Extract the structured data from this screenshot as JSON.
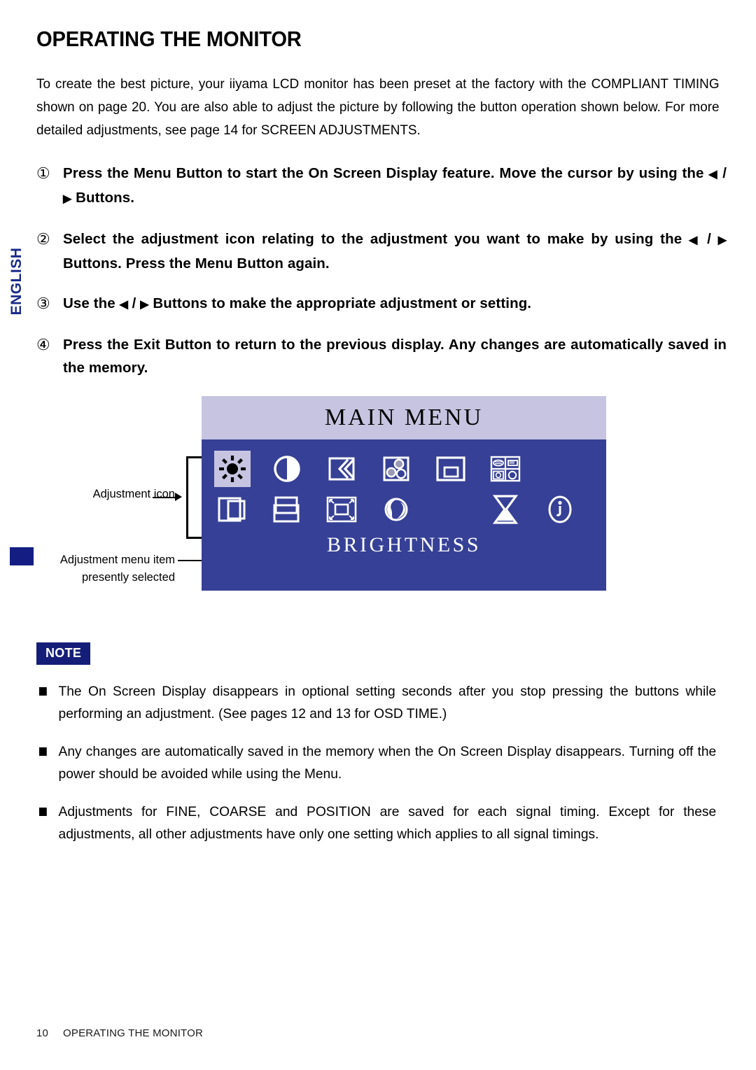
{
  "side_tab": {
    "language": "ENGLISH"
  },
  "page_title": "OPERATING THE MONITOR",
  "intro": "To create the best picture, your iiyama LCD monitor has been preset at the factory with the COMPLIANT TIMING shown on page 20. You are also able to adjust the picture by following the button operation shown below. For more detailed adjustments, see page 14 for SCREEN ADJUSTMENTS.",
  "steps": [
    {
      "marker": "①",
      "a": "Press the Menu Button to start the On Screen Display feature. Move the cursor by using the ",
      "left": "◀",
      "sep": " / ",
      "right": "▶",
      "b": " Buttons."
    },
    {
      "marker": "②",
      "a": "Select the adjustment icon relating to the adjustment you want to make by using the ",
      "left": "◀",
      "sep": " / ",
      "right": "▶",
      "b": " Buttons. Press the Menu Button again."
    },
    {
      "marker": "③",
      "a": "Use the ",
      "left": "◀",
      "sep": " / ",
      "right": "▶",
      "b": " Buttons to make the appropriate adjustment or setting."
    },
    {
      "marker": "④",
      "a": "Press the Exit Button to return to the previous display. Any changes are automatically saved in the memory.",
      "left": "",
      "sep": "",
      "right": "",
      "b": ""
    }
  ],
  "annotations": {
    "adjustment_icon": "Adjustment icon",
    "menu_item_line1": "Adjustment menu item",
    "menu_item_line2": "presently selected"
  },
  "osd": {
    "header_title": "MAIN MENU",
    "selected_item_label": "BRIGHTNESS",
    "colors": {
      "header_bg": "#c6c4e0",
      "body_bg": "#364096",
      "selected_icon_bg": "#c6c4e0",
      "icon_stroke": "#ffffff"
    },
    "icons_row1": [
      {
        "name": "brightness-icon",
        "selected": true
      },
      {
        "name": "contrast-icon",
        "selected": false
      },
      {
        "name": "sharpness-icon",
        "selected": false
      },
      {
        "name": "color-temperature-icon",
        "selected": false
      },
      {
        "name": "osd-position-icon",
        "selected": false
      },
      {
        "name": "language-icon",
        "selected": false
      }
    ],
    "icons_row2": [
      {
        "name": "horizontal-position-icon",
        "selected": false
      },
      {
        "name": "vertical-position-icon",
        "selected": false
      },
      {
        "name": "zoom-size-icon",
        "selected": false
      },
      {
        "name": "globe-icon",
        "selected": false
      },
      {
        "name": "osd-time-hourglass-icon",
        "selected": false
      },
      {
        "name": "information-icon",
        "selected": false
      }
    ]
  },
  "note": {
    "badge": "NOTE",
    "badge_color": "#141e78",
    "items": [
      "The On Screen Display disappears in optional setting seconds after you stop pressing the buttons while performing an adjustment. (See pages 12 and 13 for OSD TIME.)",
      "Any changes are automatically saved in the memory when the On Screen Display disappears. Turning off the power should be avoided while using the Menu.",
      "Adjustments for FINE, COARSE and POSITION are saved for each signal timing. Except for these adjustments, all other adjustments have only one setting which applies to all signal timings."
    ]
  },
  "footer": {
    "page_number": "10",
    "section": "OPERATING THE MONITOR"
  }
}
